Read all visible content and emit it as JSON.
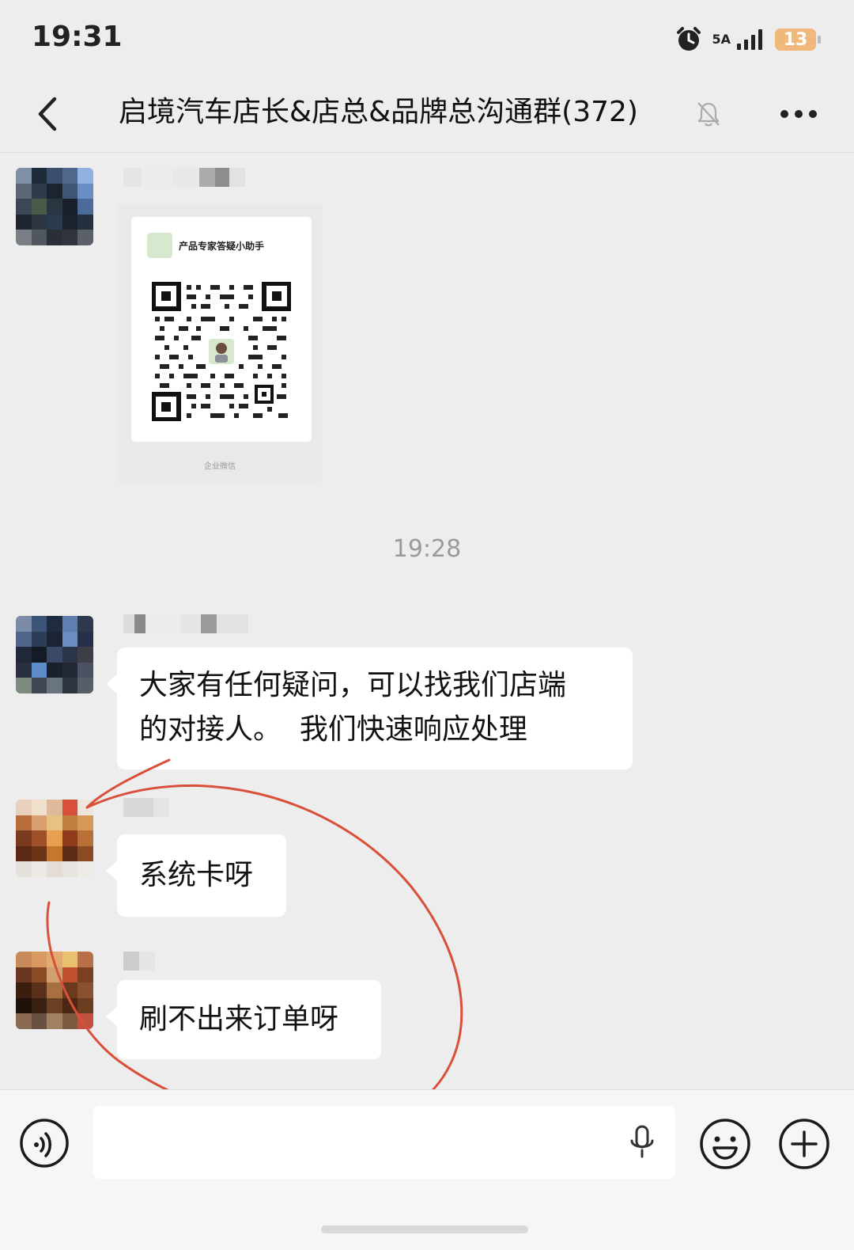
{
  "status_bar": {
    "time": "19:31",
    "network": "5A",
    "battery": "13",
    "icons": [
      "alarm-icon",
      "signal-icon",
      "battery-icon"
    ]
  },
  "nav": {
    "back_icon": "chevron-left-icon",
    "title": "启境汽车店长&店总&品牌总沟通群(372)",
    "mute_icon": "bell-off-icon",
    "more_icon": "more-dots-icon"
  },
  "messages": [
    {
      "type": "qr_card",
      "card_title": "产品专家答疑小助手",
      "card_footer": "企业微信"
    },
    {
      "type": "time",
      "text": "19:28"
    },
    {
      "type": "text",
      "lines": [
        "大家有任何疑问，可以找我们店端",
        "的对接人。  我们快速响应处理"
      ]
    },
    {
      "type": "text",
      "text": "系统卡呀"
    },
    {
      "type": "text",
      "text": "刷不出来订单呀"
    }
  ],
  "input_bar": {
    "value": "",
    "voice_icon": "voice-icon",
    "mic_icon": "mic-icon",
    "emoji_icon": "emoji-icon",
    "plus_icon": "plus-icon"
  },
  "colors": {
    "background": "#ededed",
    "bubble": "#ffffff",
    "annotation": "#d9503a",
    "battery": "#f0b87a"
  }
}
